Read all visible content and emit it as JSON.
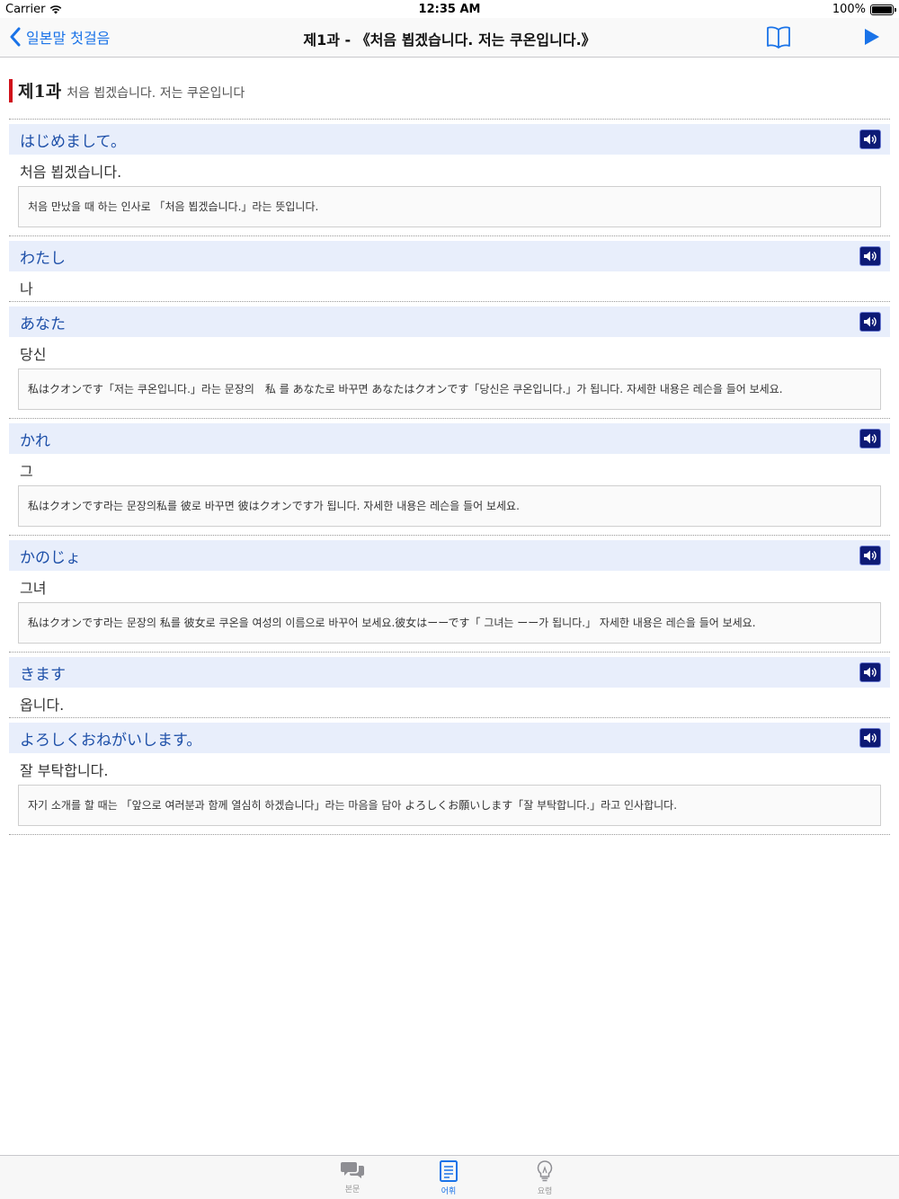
{
  "status": {
    "carrier": "Carrier",
    "time": "12:35 AM",
    "battery": "100%"
  },
  "nav": {
    "back_label": "일본말 첫걸음",
    "title": "제1과 - 《처음 뵙겠습니다. 저는 쿠온입니다.》"
  },
  "lesson": {
    "number": "제1과",
    "subtitle": "처음 뵙겠습니다. 저는 쿠온입니다"
  },
  "entries": [
    {
      "jp": "はじめまして。",
      "ko": "처음 뵙겠습니다.",
      "note": "처음 만났을 때 하는 인사로 「처음 뵙겠습니다.」라는 뜻입니다."
    },
    {
      "jp": "わたし",
      "ko": "나",
      "note": ""
    },
    {
      "jp": "あなた",
      "ko": "당신",
      "note": "私はクオンです「저는 쿠온입니다.」라는 문장의　私 를 あなた로 바꾸면 あなたはクオンです「당신은 쿠온입니다.」가 됩니다. 자세한 내용은 레슨을 들어 보세요."
    },
    {
      "jp": "かれ",
      "ko": "그",
      "note": "私はクオンです라는 문장의私를 彼로 바꾸면 彼はクオンです가 됩니다. 자세한 내용은 레슨을 들어 보세요."
    },
    {
      "jp": "かのじょ",
      "ko": "그녀",
      "note": "私はクオンです라는 문장의 私를 彼女로 쿠온을 여성의 이름으로 바꾸어 보세요.彼女はーーです「 그녀는 ーー가 됩니다.」 자세한 내용은 레슨을 들어 보세요."
    },
    {
      "jp": "きます",
      "ko": "옵니다.",
      "note": ""
    },
    {
      "jp": "よろしくおねがいします。",
      "ko": "잘 부탁합니다.",
      "note": "자기 소개를 할 때는 「앞으로 여러분과 함께 열심히 하겠습니다」라는 마음을 담아 よろしくお願いします「잘 부탁합니다.」라고 인사합니다."
    }
  ],
  "tabs": [
    {
      "label": "본문",
      "icon": "chat-bubbles-icon",
      "active": false
    },
    {
      "label": "어휘",
      "icon": "document-icon",
      "active": true
    },
    {
      "label": "요령",
      "icon": "lightbulb-icon",
      "active": false
    }
  ],
  "colors": {
    "accent": "#1a73e8",
    "lesson_bar": "#d0111b",
    "entry_head_bg": "#e8eefb",
    "entry_jp": "#1d4fa8",
    "sound_button": "#0d1a75"
  }
}
